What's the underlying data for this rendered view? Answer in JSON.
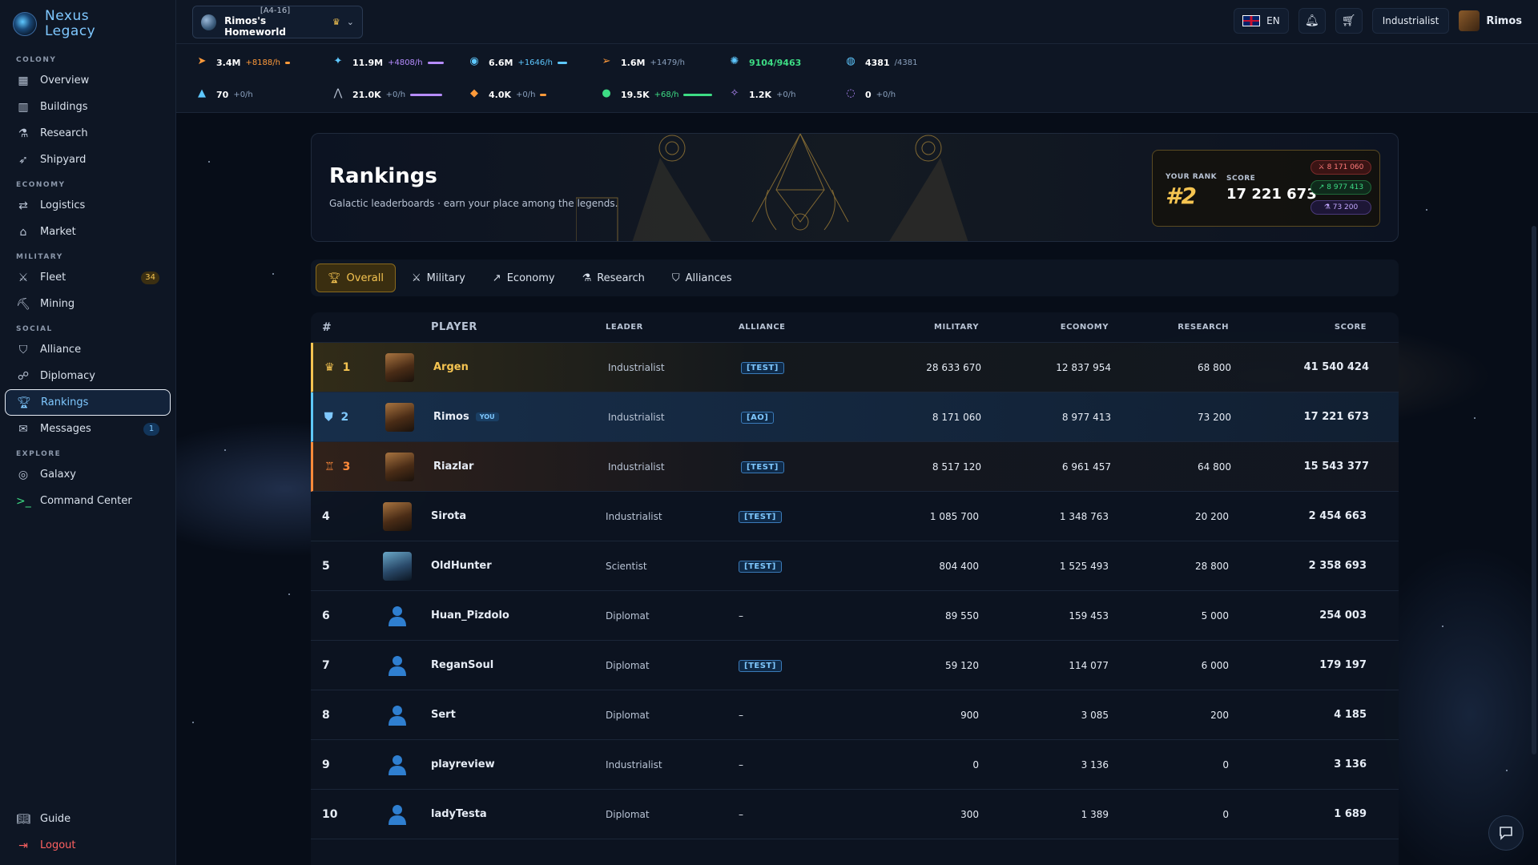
{
  "app": {
    "logo_line1": "Nexus",
    "logo_line2": "Legacy"
  },
  "sidebar": {
    "sections": {
      "colony": "COLONY",
      "economy": "ECONOMY",
      "military": "MILITARY",
      "social": "SOCIAL",
      "explore": "EXPLORE"
    },
    "items": {
      "overview": "Overview",
      "buildings": "Buildings",
      "research": "Research",
      "shipyard": "Shipyard",
      "logistics": "Logistics",
      "market": "Market",
      "fleet": "Fleet",
      "fleet_badge": "34",
      "mining": "Mining",
      "alliance": "Alliance",
      "diplomacy": "Diplomacy",
      "rankings": "Rankings",
      "messages": "Messages",
      "messages_badge": "1",
      "galaxy": "Galaxy",
      "command_center": "Command Center",
      "guide": "Guide",
      "logout": "Logout"
    }
  },
  "topbar": {
    "planet_coords": "[A4-16]",
    "planet_name": "Rimos's Homeworld",
    "language": "EN",
    "role": "Industrialist",
    "username": "Rimos"
  },
  "resources": [
    {
      "value": "3.4M",
      "rate": "+8188/h",
      "color": "#ff9a3a"
    },
    {
      "value": "11.9M",
      "rate": "+4808/h",
      "color": "#b68cff"
    },
    {
      "value": "6.6M",
      "rate": "+1646/h",
      "color": "#5ec8ff"
    },
    {
      "value": "1.6M",
      "rate": "+1479/h",
      "color": "#8aa0bd"
    },
    {
      "value": "9104/9463",
      "rate": "",
      "color": "#3ddc84"
    },
    {
      "value": "4381",
      "rate": "/4381",
      "color": "#8aa0bd"
    },
    {
      "value": "70",
      "rate": "+0/h",
      "color": "#8aa0bd"
    },
    {
      "value": "21.0K",
      "rate": "+0/h",
      "color": "#b68cff"
    },
    {
      "value": "4.0K",
      "rate": "+0/h",
      "color": "#ff9a3a"
    },
    {
      "value": "19.5K",
      "rate": "+68/h",
      "color": "#3ddc84"
    },
    {
      "value": "1.2K",
      "rate": "+0/h",
      "color": "#8aa0bd"
    },
    {
      "value": "0",
      "rate": "+0/h",
      "color": "#8aa0bd"
    }
  ],
  "banner": {
    "title": "Rankings",
    "subtitle": "Galactic leaderboards · earn your place among the legends.",
    "your_rank_label": "YOUR RANK",
    "your_rank": "#2",
    "score_label": "SCORE",
    "score": "17 221 673",
    "military": "8 171 060",
    "economy": "8 977 413",
    "research": "73 200"
  },
  "tabs": [
    "Overview",
    "Military",
    "Economy",
    "Research",
    "Alliances"
  ],
  "tabs_labels": {
    "overall": "Overall",
    "military": "Military",
    "economy": "Economy",
    "research": "Research",
    "alliances": "Alliances"
  },
  "table": {
    "headers": {
      "rank": "#",
      "player": "PLAYER",
      "leader": "LEADER",
      "alliance": "ALLIANCE",
      "military": "MILITARY",
      "economy": "ECONOMY",
      "research": "RESEARCH",
      "score": "SCORE"
    },
    "you_label": "YOU",
    "rows": [
      {
        "rank": "1",
        "player": "Argen",
        "leader": "Industrialist",
        "alliance": "[TEST]",
        "military": "28 633 670",
        "economy": "12 837 954",
        "research": "68 800",
        "score": "41 540 424"
      },
      {
        "rank": "2",
        "player": "Rimos",
        "leader": "Industrialist",
        "alliance": "[AO]",
        "military": "8 171 060",
        "economy": "8 977 413",
        "research": "73 200",
        "score": "17 221 673"
      },
      {
        "rank": "3",
        "player": "Riazlar",
        "leader": "Industrialist",
        "alliance": "[TEST]",
        "military": "8 517 120",
        "economy": "6 961 457",
        "research": "64 800",
        "score": "15 543 377"
      },
      {
        "rank": "4",
        "player": "Sirota",
        "leader": "Industrialist",
        "alliance": "[TEST]",
        "military": "1 085 700",
        "economy": "1 348 763",
        "research": "20 200",
        "score": "2 454 663"
      },
      {
        "rank": "5",
        "player": "OldHunter",
        "leader": "Scientist",
        "alliance": "[TEST]",
        "military": "804 400",
        "economy": "1 525 493",
        "research": "28 800",
        "score": "2 358 693"
      },
      {
        "rank": "6",
        "player": "Huan_Pizdolo",
        "leader": "Diplomat",
        "alliance": "–",
        "military": "89 550",
        "economy": "159 453",
        "research": "5 000",
        "score": "254 003"
      },
      {
        "rank": "7",
        "player": "ReganSoul",
        "leader": "Diplomat",
        "alliance": "[TEST]",
        "military": "59 120",
        "economy": "114 077",
        "research": "6 000",
        "score": "179 197"
      },
      {
        "rank": "8",
        "player": "Sert",
        "leader": "Diplomat",
        "alliance": "–",
        "military": "900",
        "economy": "3 085",
        "research": "200",
        "score": "4 185"
      },
      {
        "rank": "9",
        "player": "playreview",
        "leader": "Industrialist",
        "alliance": "–",
        "military": "0",
        "economy": "3 136",
        "research": "0",
        "score": "3 136"
      },
      {
        "rank": "10",
        "player": "ladyTesta",
        "leader": "Diplomat",
        "alliance": "–",
        "military": "300",
        "economy": "1 389",
        "research": "0",
        "score": "1 689"
      }
    ]
  }
}
